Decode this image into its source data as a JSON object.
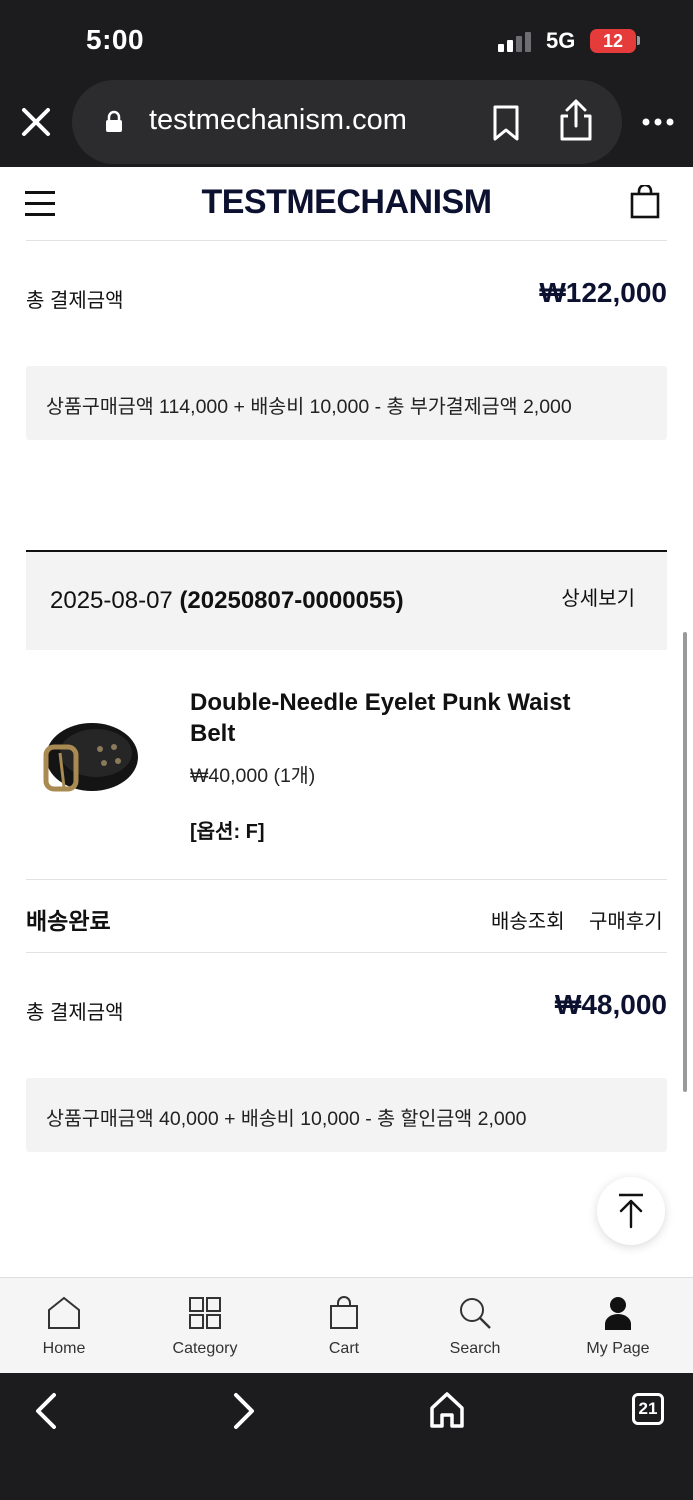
{
  "status_bar": {
    "time": "5:00",
    "network": "5G",
    "battery": "12"
  },
  "browser": {
    "url": "testmechanism.com",
    "tab_count": "21"
  },
  "site": {
    "brand": "TESTMECHANISM"
  },
  "order_prev": {
    "total_label": "총 결제금액",
    "total_amount": "₩122,000",
    "summary": "상품구매금액 114,000 + 배송비 10,000 - 총 부가결제금액 2,000"
  },
  "order": {
    "date": "2025-08-07",
    "number": "(20250807-0000055)",
    "detail_label": "상세보기",
    "product": {
      "name": "Double-Needle Eyelet Punk Waist Belt",
      "price_qty": "₩40,000 (1개)",
      "option": "[옵션: F]"
    },
    "shipping_status": "배송완료",
    "track_label": "배송조회",
    "review_label": "구매후기",
    "total_label": "총 결제금액",
    "total_amount": "₩48,000",
    "summary": "상품구매금액 40,000 + 배송비 10,000 - 총 할인금액 2,000"
  },
  "tabbar": {
    "items": [
      {
        "label": "Home",
        "icon": "home-icon"
      },
      {
        "label": "Category",
        "icon": "grid-icon"
      },
      {
        "label": "Cart",
        "icon": "bag-icon"
      },
      {
        "label": "Search",
        "icon": "search-icon"
      },
      {
        "label": "My Page",
        "icon": "person-icon"
      }
    ]
  }
}
